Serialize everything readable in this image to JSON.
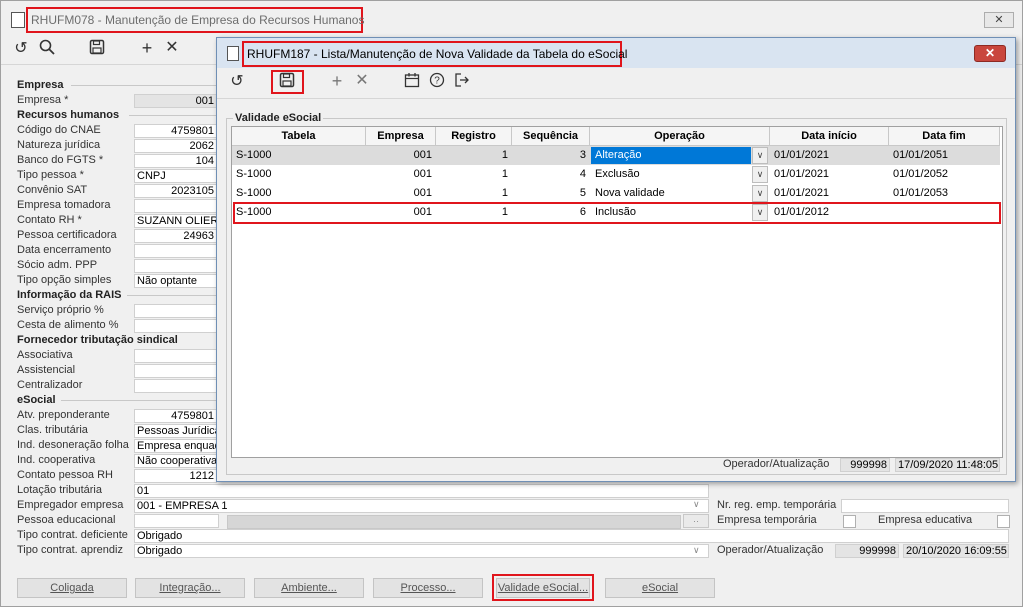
{
  "main_window": {
    "title": "RHUFM078 - Manutenção de Empresa do Recursos Humanos",
    "close": "✕",
    "toolbar": [
      "refresh-icon",
      "search-icon",
      "save-icon",
      "add-icon",
      "delete-icon"
    ]
  },
  "sections": {
    "empresa": "Empresa",
    "recursos": "Recursos humanos",
    "rais": "Informação da RAIS",
    "fornecedor": "Fornecedor tributação sindical",
    "esocial": "eSocial"
  },
  "fields": {
    "empresa": {
      "label": "Empresa *",
      "value": "001"
    },
    "cnae": {
      "label": "Código do CNAE",
      "value": "4759801"
    },
    "natureza": {
      "label": "Natureza jurídica",
      "value": "2062"
    },
    "fgts": {
      "label": "Banco do FGTS *",
      "value": "104"
    },
    "tipo_pessoa": {
      "label": "Tipo pessoa *",
      "value": "CNPJ"
    },
    "convenio": {
      "label": "Convênio SAT",
      "value": "2023105"
    },
    "tomadora": {
      "label": "Empresa tomadora",
      "value": ""
    },
    "contato_rh": {
      "label": "Contato RH *",
      "value": "SUZANN OLIER D"
    },
    "certificadora": {
      "label": "Pessoa certificadora",
      "value": "24963"
    },
    "encerramento": {
      "label": "Data encerramento",
      "value": ""
    },
    "socio": {
      "label": "Sócio adm. PPP",
      "value": ""
    },
    "opcao_simples": {
      "label": "Tipo opção simples",
      "value": "Não optante"
    },
    "servico": {
      "label": "Serviço próprio %",
      "value": ""
    },
    "cesta": {
      "label": "Cesta de alimento %",
      "value": ""
    },
    "associativa": {
      "label": "Associativa",
      "value": ""
    },
    "assistencial": {
      "label": "Assistencial",
      "value": ""
    },
    "centralizador": {
      "label": "Centralizador",
      "value": ""
    },
    "atv": {
      "label": "Atv. preponderante",
      "value": "4759801"
    },
    "clas": {
      "label": "Clas. tributária",
      "value": "Pessoas Jurídica"
    },
    "desoneracao": {
      "label": "Ind. desoneração folha",
      "value": "Empresa enquad"
    },
    "cooperativa": {
      "label": "Ind. cooperativa",
      "value": "Não cooperativa"
    },
    "contato_pessoa": {
      "label": "Contato pessoa RH",
      "value": "1212"
    },
    "lotacao": {
      "label": "Lotação tributária",
      "value": "01"
    },
    "empregador": {
      "label": "Empregador empresa",
      "value": "001 - EMPRESA 1"
    },
    "educacional": {
      "label": "Pessoa educacional",
      "value": ""
    },
    "deficiente": {
      "label": "Tipo contrat. deficiente",
      "value": "Obrigado"
    },
    "aprendiz": {
      "label": "Tipo contrat. aprendiz",
      "value": "Obrigado"
    }
  },
  "right_fields": {
    "nr_reg": "Nr. reg. emp. temporária",
    "emp_temp": "Empresa temporária",
    "emp_edu": "Empresa educativa",
    "operador_label": "Operador/Atualização",
    "operador": "999998",
    "atualizacao": "20/10/2020 16:09:55"
  },
  "bottom_buttons": [
    "Coligada",
    "Integração...",
    "Ambiente...",
    "Processo...",
    "Validade eSocial...",
    "eSocial"
  ],
  "dialog": {
    "title": "RHUFM187 - Lista/Manutenção de Nova Validade da Tabela do eSocial",
    "close": "✕",
    "group_label": "Validade eSocial",
    "columns": [
      "Tabela",
      "Empresa",
      "Registro",
      "Sequência",
      "Operação",
      "Data início",
      "Data fim"
    ],
    "rows": [
      {
        "tabela": "S-1000",
        "empresa": "001",
        "registro": "1",
        "sequencia": "3",
        "operacao": "Alteração",
        "inicio": "01/01/2021",
        "fim": "01/01/2051"
      },
      {
        "tabela": "S-1000",
        "empresa": "001",
        "registro": "1",
        "sequencia": "4",
        "operacao": "Exclusão",
        "inicio": "01/01/2021",
        "fim": "01/01/2052"
      },
      {
        "tabela": "S-1000",
        "empresa": "001",
        "registro": "1",
        "sequencia": "5",
        "operacao": "Nova validade",
        "inicio": "01/01/2021",
        "fim": "01/01/2053"
      },
      {
        "tabela": "S-1000",
        "empresa": "001",
        "registro": "1",
        "sequencia": "6",
        "operacao": "Inclusão",
        "inicio": "01/01/2012",
        "fim": ""
      }
    ],
    "operador_label": "Operador/Atualização",
    "operador": "999998",
    "atualizacao": "17/09/2020 11:48:05",
    "accent": "#0078d7",
    "highlight": "#e0151c"
  }
}
